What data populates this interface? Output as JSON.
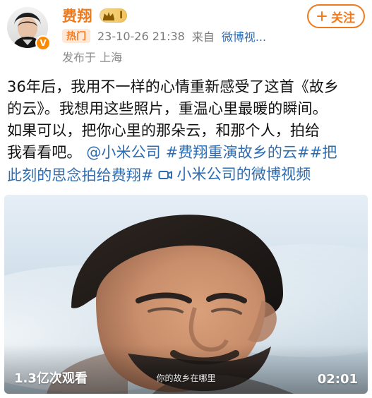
{
  "header": {
    "username": "费翔",
    "level_badge": "I",
    "hot_badge": "热门",
    "timestamp": "23-10-26 21:38",
    "source_prefix": "来自",
    "source_name": "微博视...",
    "location": "发布于 上海",
    "follow_label": "关注",
    "verified_badge": "V"
  },
  "post": {
    "lines": [
      "36年后，我用不一样的心情重新感受了这首《故乡",
      "的云》。我想用这些照片，重温心里最暖的瞬间。",
      "如果可以，把你心里的那朵云，和那个人，拍给",
      "我看看吧。"
    ],
    "mention": "@小米公司",
    "hashtag_1": "#费翔重演故乡的云#",
    "hashtag_2_part1": "#把",
    "hashtag_2_part2": "此刻的思念拍给费翔#",
    "video_link": "小米公司的微博视频"
  },
  "video": {
    "views": "1.3亿次观看",
    "duration": "02:01",
    "subtitle": "你的故乡在哪里"
  },
  "colors": {
    "accent_orange": "#f07a1b",
    "link_blue": "#2e6db3",
    "meta_gray": "#7a7a7a"
  },
  "icons": {
    "verified": "verified-badge-icon",
    "crown": "crown-icon",
    "plus": "plus-icon",
    "video": "video-camera-icon"
  }
}
